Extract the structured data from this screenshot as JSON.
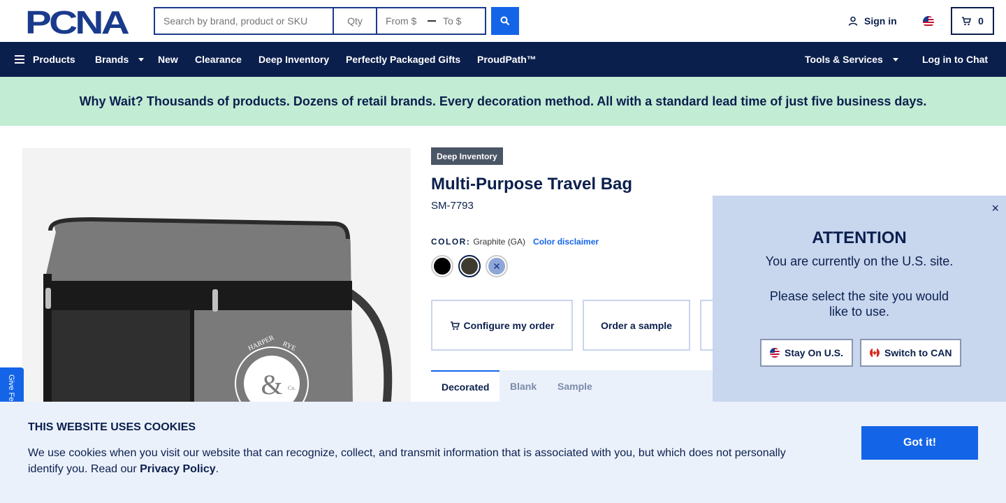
{
  "header": {
    "logo_text": "PCNA",
    "search_placeholder": "Search by brand, product or SKU",
    "qty_placeholder": "Qty",
    "price_from_placeholder": "From $",
    "price_to_placeholder": "To $",
    "signin_label": "Sign in",
    "cart_count": "0"
  },
  "nav": {
    "items": [
      "Products",
      "Brands",
      "New",
      "Clearance",
      "Deep Inventory",
      "Perfectly Packaged Gifts",
      "ProudPath™"
    ],
    "right_items": [
      "Tools & Services",
      "Log in to Chat"
    ]
  },
  "banner": {
    "text": "Why Wait? Thousands of products. Dozens of retail brands. Every decoration method. All with a standard lead time of just five business days."
  },
  "product": {
    "badge": "Deep Inventory",
    "title": "Multi-Purpose Travel Bag",
    "sku": "SM-7793",
    "color_label": "COLOR:",
    "color_value": "Graphite (GA)",
    "color_disclaimer": "Color disclaimer",
    "swatch_colors": [
      "#000000",
      "#3d3a30",
      "#8fa6d8"
    ],
    "actions": [
      "Configure my order",
      "Order a sample"
    ],
    "tabs": [
      "Decorated",
      "Blank",
      "Sample"
    ],
    "image_print": {
      "line1": "HARPER",
      "line2": "RYE",
      "mark": "&",
      "sub": "Co."
    }
  },
  "feedback": {
    "label": "Give Feedback"
  },
  "attention": {
    "close": "×",
    "title": "ATTENTION",
    "line1": "You are currently on the U.S. site.",
    "line2": "Please select the site you would like to use.",
    "stay_label": "Stay On U.S.",
    "switch_label": "Switch to CAN"
  },
  "cookie": {
    "title": "THIS WEBSITE USES COOKIES",
    "text": "We use cookies when you visit our website that can recognize, collect, and transmit information that is associated with you, but which does not personally identify you. Read our ",
    "policy_link": "Privacy Policy",
    "period": ".",
    "button": "Got it!"
  }
}
